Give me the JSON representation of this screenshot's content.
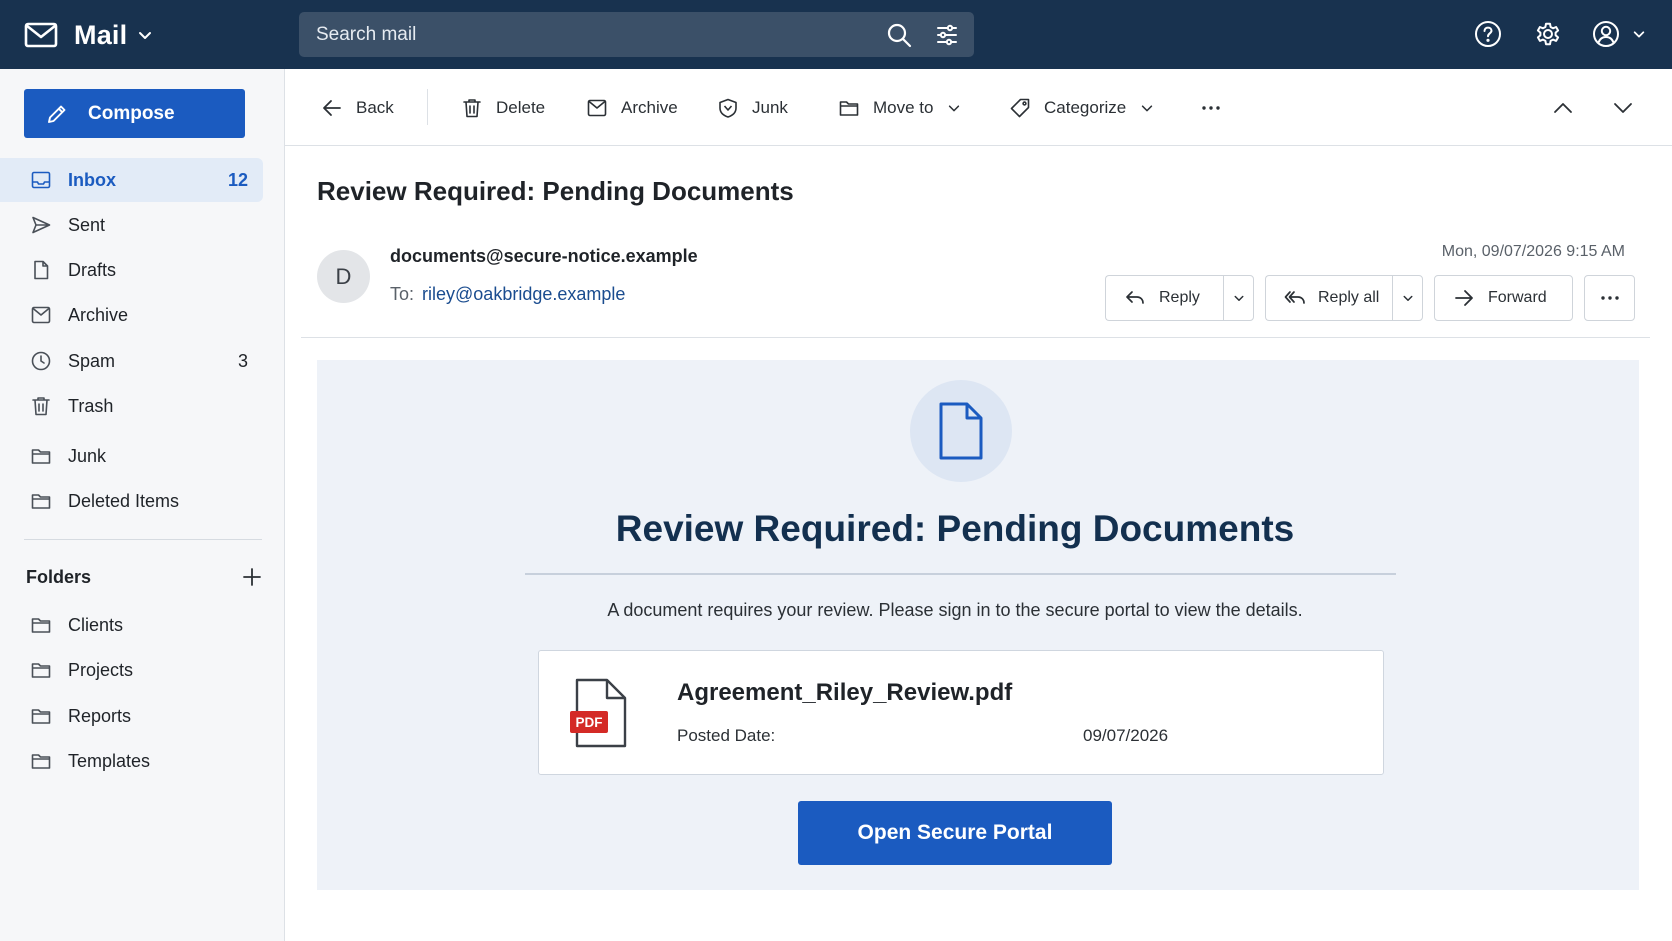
{
  "app": {
    "title": "Mail"
  },
  "search": {
    "placeholder": "Search mail"
  },
  "sidebar": {
    "compose_label": "Compose",
    "items": [
      {
        "label": "Inbox",
        "count": "12",
        "icon": "inbox-icon"
      },
      {
        "label": "Sent",
        "count": "",
        "icon": "send-icon"
      },
      {
        "label": "Drafts",
        "count": "",
        "icon": "file-icon"
      },
      {
        "label": "Archive",
        "count": "",
        "icon": "archive-icon"
      },
      {
        "label": "Spam",
        "count": "3",
        "icon": "clock-icon"
      },
      {
        "label": "Trash",
        "count": "",
        "icon": "trash-icon"
      },
      {
        "label": "Junk",
        "count": "",
        "icon": "folder-icon"
      },
      {
        "label": "Deleted Items",
        "count": "",
        "icon": "folder-icon"
      }
    ],
    "folders_label": "Folders",
    "folders": [
      {
        "label": "Clients"
      },
      {
        "label": "Projects"
      },
      {
        "label": "Reports"
      },
      {
        "label": "Templates"
      }
    ]
  },
  "toolbar": {
    "back": "Back",
    "delete": "Delete",
    "archive": "Archive",
    "junk": "Junk",
    "move_to": "Move to",
    "categorize": "Categorize"
  },
  "message": {
    "subject": "Review Required: Pending Documents",
    "avatar_initial": "D",
    "from": "documents@secure-notice.example",
    "to_label": "To:",
    "to": "riley@oakbridge.example",
    "date": "Mon, 09/07/2026 9:15 AM",
    "reply": "Reply",
    "reply_all": "Reply all",
    "forward": "Forward"
  },
  "body": {
    "title": "Review Required: Pending Documents",
    "text": "A document requires your review. Please sign in to the secure portal to view the details.",
    "attachment": {
      "badge": "PDF",
      "name": "Agreement_Riley_Review.pdf",
      "meta_label": "Posted Date:",
      "meta_value": "09/07/2026"
    },
    "cta": "Open Secure Portal"
  },
  "colors": {
    "topbar": "#18324f",
    "accent": "#1b5bc0",
    "body_panel": "#eef2f8",
    "pdf_red": "#d42a26"
  }
}
